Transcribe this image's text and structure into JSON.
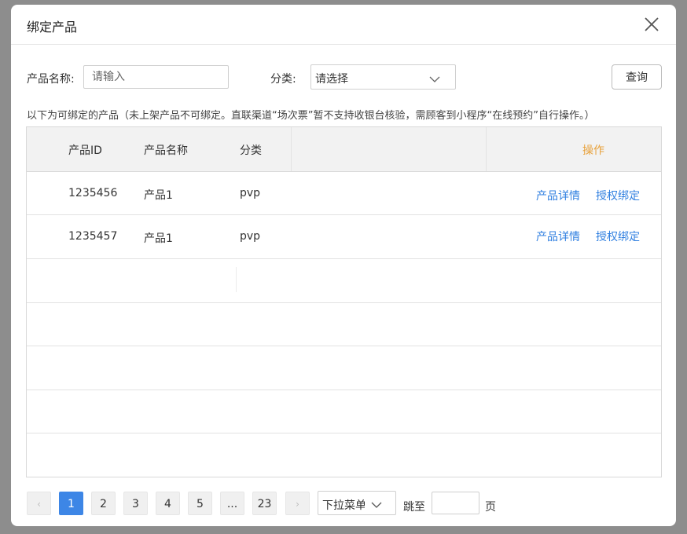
{
  "dialog": {
    "title": "绑定产品"
  },
  "filters": {
    "name_label": "产品名称:",
    "name_placeholder": "请输入",
    "category_label": "分类:",
    "category_value": "请选择",
    "query_label": "查询"
  },
  "notice": "以下为可绑定的产品（未上架产品不可绑定。直联渠道“场次票”暂不支持收银台核验，需顾客到小程序“在线预约”自行操作。）",
  "table": {
    "headers": {
      "id": "产品ID",
      "name": "产品名称",
      "category": "分类",
      "action": "操作"
    },
    "rows": [
      {
        "id": "1235456",
        "name": "产品1",
        "category": "pvp",
        "detail": "产品详情",
        "bind": "授权绑定"
      },
      {
        "id": "1235457",
        "name": "产品1",
        "category": "pvp",
        "detail": "产品详情",
        "bind": "授权绑定"
      }
    ]
  },
  "pagination": {
    "prev": "‹",
    "next": "›",
    "pages": [
      "1",
      "2",
      "3",
      "4",
      "5",
      "...",
      "23"
    ],
    "current": "1",
    "page_size_label": "下拉菜单",
    "goto_label": "跳至",
    "goto_suffix": "页"
  },
  "colors": {
    "link": "#2f7fe0",
    "action_header": "#e8a23c",
    "active_page": "#3d86e6"
  }
}
